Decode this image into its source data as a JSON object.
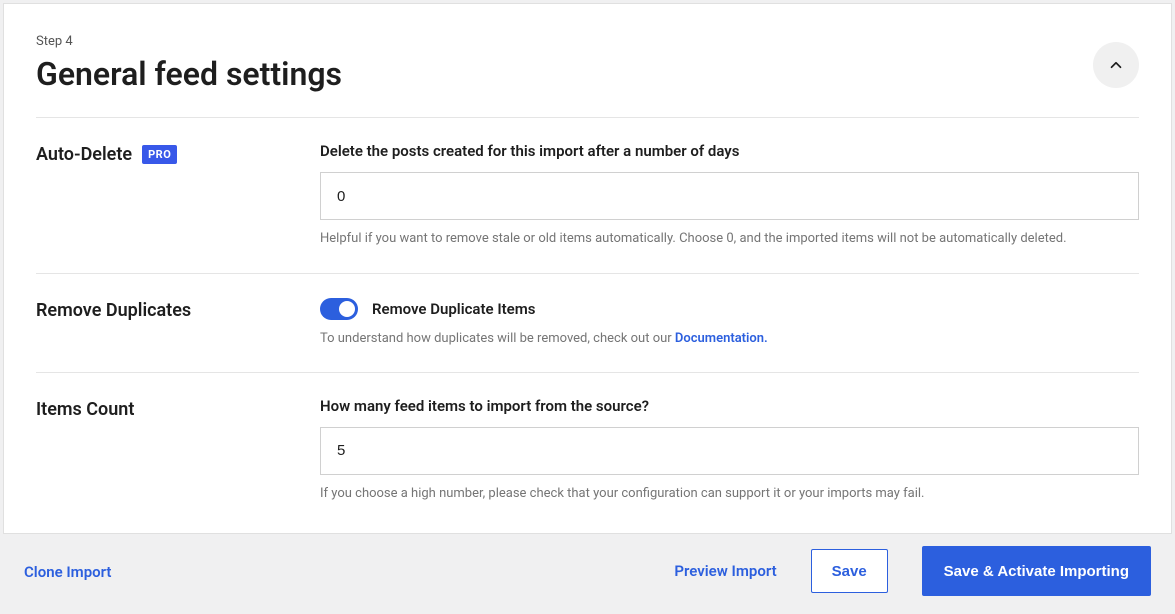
{
  "header": {
    "step_label": "Step 4",
    "title": "General feed settings"
  },
  "settings": {
    "auto_delete": {
      "label": "Auto-Delete",
      "pro_badge": "PRO",
      "field_title": "Delete the posts created for this import after a number of days",
      "value": "0",
      "help": "Helpful if you want to remove stale or old items automatically. Choose 0, and the imported items will not be automatically deleted."
    },
    "remove_duplicates": {
      "label": "Remove Duplicates",
      "toggle_label": "Remove Duplicate Items",
      "toggle_on": true,
      "help_prefix": "To understand how duplicates will be removed, check out our ",
      "doc_link_text": "Documentation."
    },
    "items_count": {
      "label": "Items Count",
      "field_title": "How many feed items to import from the source?",
      "value": "5",
      "help": "If you choose a high number, please check that your configuration can support it or your imports may fail."
    }
  },
  "footer": {
    "clone_import": "Clone Import",
    "preview_import": "Preview Import",
    "save": "Save",
    "save_activate": "Save & Activate Importing"
  }
}
